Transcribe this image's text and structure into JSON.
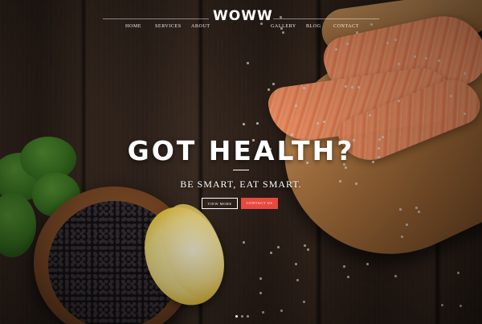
{
  "brand": {
    "logo_text": "WOWW"
  },
  "nav": {
    "items": [
      {
        "label": "HOME"
      },
      {
        "label": "SERVICES"
      },
      {
        "label": "ABOUT"
      },
      {
        "label": "GALLERY"
      },
      {
        "label": "BLOG"
      },
      {
        "label": "CONTACT"
      }
    ]
  },
  "hero": {
    "headline": "GOT HEALTH?",
    "tagline": "BE SMART, EAT SMART.",
    "buttons": {
      "view_more": "VIEW MORE",
      "contact_us": "CONTACT US"
    }
  },
  "slider": {
    "dot_count": 3,
    "active_index": 0
  },
  "colors": {
    "accent": "#e8483d",
    "text": "#ffffff",
    "background": "#2d211a"
  }
}
